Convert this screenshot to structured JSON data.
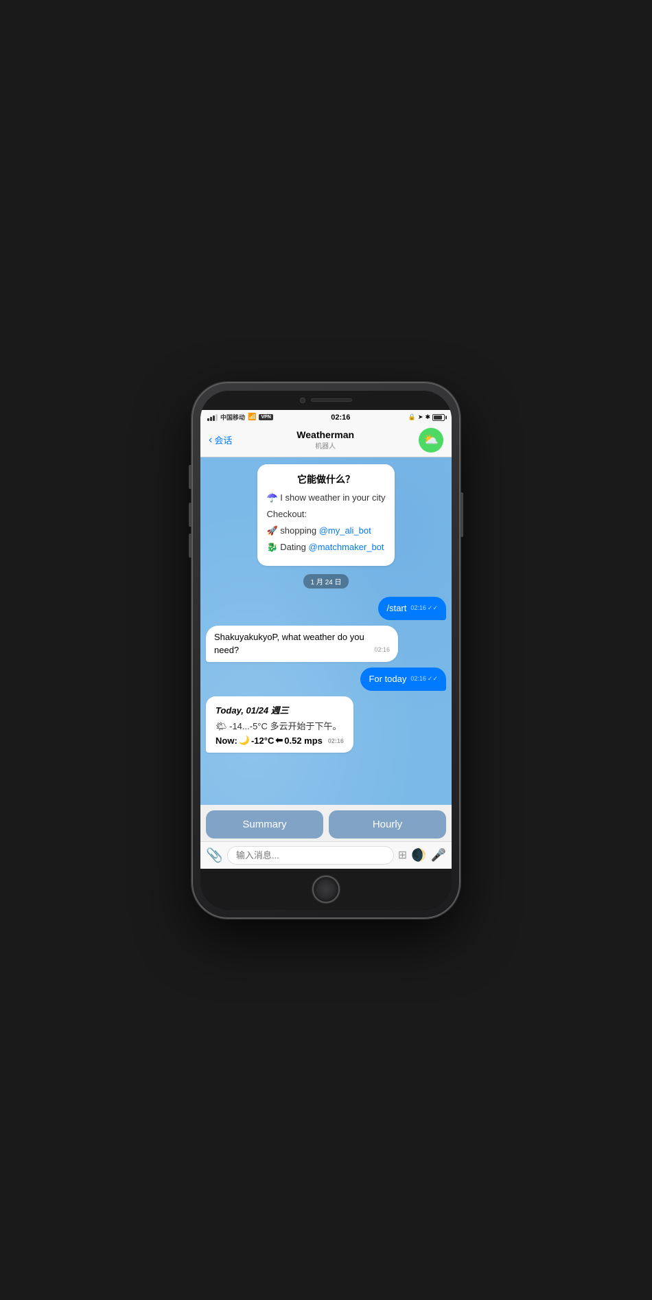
{
  "status_bar": {
    "carrier": "中国移动",
    "wifi": "wifi",
    "vpn": "VPN",
    "time": "02:16",
    "lock_icon": "🔒",
    "location_icon": "➤",
    "bluetooth_icon": "✱"
  },
  "nav": {
    "back_label": "会话",
    "title": "Weatherman",
    "subtitle": "机器人",
    "avatar_emoji": "⛅"
  },
  "intro_bubble": {
    "title": "它能做什么？",
    "line1": "☂️ I show weather in your city",
    "checkout_label": "Checkout:",
    "shopping_text": "🚀 shopping ",
    "shopping_link": "@my_ali_bot",
    "dating_text": "🐉 Dating ",
    "dating_link": "@matchmaker_bot"
  },
  "date_separator": "1 月 24 日",
  "messages": [
    {
      "id": "msg1",
      "type": "outgoing",
      "text": "/start",
      "time": "02:16",
      "has_checks": true
    },
    {
      "id": "msg2",
      "type": "incoming",
      "text": "ShakuyakukyoP, what weather do you need?",
      "time": "02:16"
    },
    {
      "id": "msg3",
      "type": "outgoing",
      "text": "For today",
      "time": "02:16",
      "has_checks": true
    },
    {
      "id": "msg4",
      "type": "weather",
      "date_line": "Today, 01/24 週三",
      "temp_line": "🌤 -14...-5°C 多云开始于下午。",
      "now_label": "Now:",
      "now_emoji": "🌙",
      "now_temp": "-12°C",
      "now_wind_emoji": "⬅",
      "now_wind": "0.52 mps",
      "time": "02:16"
    }
  ],
  "quick_replies": {
    "summary_label": "Summary",
    "hourly_label": "Hourly"
  },
  "input_bar": {
    "placeholder": "输入消息..."
  }
}
